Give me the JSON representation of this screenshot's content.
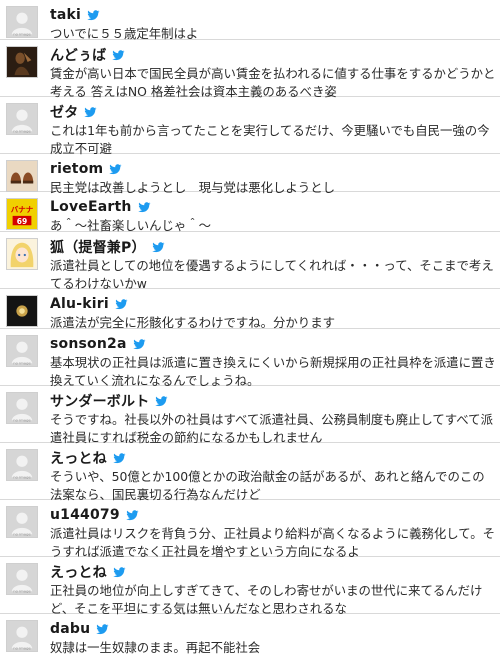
{
  "timeline": {
    "placeholder_avatar_text": "no image",
    "banana_avatar_text": "バナナ",
    "banana_avatar_number": "69",
    "tweets": [
      {
        "user": "taki",
        "avatar": "placeholder",
        "text": "ついでに５５歳定年制はよ"
      },
      {
        "user": "んどぅば",
        "avatar": "dark-figure",
        "text": "賃金が高い日本で国民全員が高い賃金を払われるに値する仕事をするかどうかと考える 答えはNO 格差社会は資本主義のあるべき姿"
      },
      {
        "user": "ゼタ",
        "avatar": "placeholder",
        "text": "これは1年も前から言ってたことを実行してるだけ、今更騒いでも自民一強の今成立不可避"
      },
      {
        "user": "rietom",
        "avatar": "shoes",
        "text": "民主党は改善しようとし　現与党は悪化しようとし"
      },
      {
        "user": "LoveEarth",
        "avatar": "banana-sticker",
        "text": "あ＾～社畜楽しいんじゃ＾～"
      },
      {
        "user": "狐（提督兼P）",
        "avatar": "anime-girl",
        "text": "派遣社員としての地位を優遇するようにしてくれれば・・・って、そこまで考えてるわけないかw"
      },
      {
        "user": "Alu-kiri",
        "avatar": "dark-glow",
        "text": "派遣法が完全に形骸化するわけですね。分かります"
      },
      {
        "user": "sonson2a",
        "avatar": "placeholder",
        "text": "基本現状の正社員は派遣に置き換えにくいから新規採用の正社員枠を派遣に置き換えていく流れになるんでしょうね。"
      },
      {
        "user": "サンダーボルト",
        "avatar": "placeholder",
        "text": "そうですね。社長以外の社員はすべて派遣社員、公務員制度も廃止してすべて派遣社員にすれば税金の節約になるかもしれません"
      },
      {
        "user": "えっとね",
        "avatar": "placeholder",
        "text": "そういや、50億とか100億とかの政治献金の話があるが、あれと絡んでのこの法案なら、国民裏切る行為なんだけど"
      },
      {
        "user": "u144079",
        "avatar": "placeholder",
        "text": "派遣社員はリスクを背負う分、正社員より給料が高くなるように義務化して。そうすれば派遣でなく正社員を増やすという方向になるよ"
      },
      {
        "user": "えっとね",
        "avatar": "placeholder",
        "text": "正社員の地位が向上しすぎてきて、そのしわ寄せがいまの世代に来てるんだけど、そこを平坦にする気は無いんだなと思わされるな"
      },
      {
        "user": "dabu",
        "avatar": "placeholder",
        "text": "奴隷は一生奴隷のまま。再起不能社会"
      }
    ]
  }
}
